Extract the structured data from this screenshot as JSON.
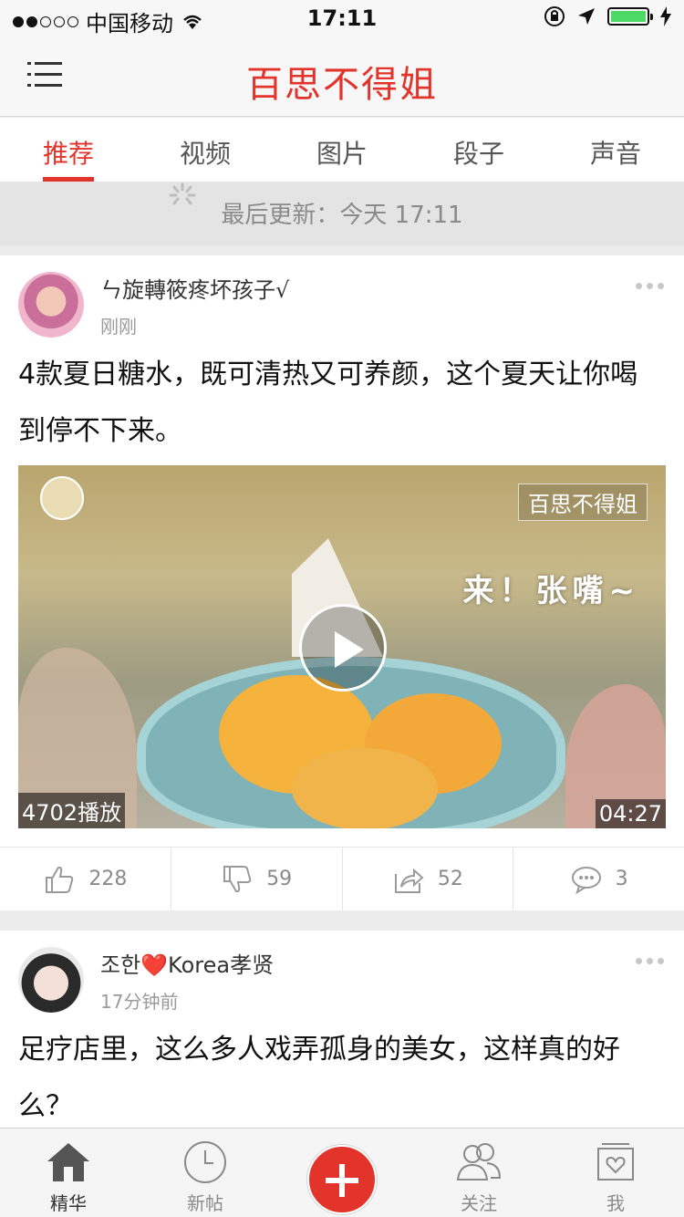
{
  "status_bar": {
    "carrier": "中国移动",
    "time": "17:11"
  },
  "nav": {
    "title": "百思不得姐"
  },
  "tabs": [
    {
      "label": "推荐",
      "active": true
    },
    {
      "label": "视频",
      "active": false
    },
    {
      "label": "图片",
      "active": false
    },
    {
      "label": "段子",
      "active": false
    },
    {
      "label": "声音",
      "active": false
    }
  ],
  "refresh": {
    "text": "最后更新：今天 17:11"
  },
  "posts": [
    {
      "username": "ㄣ旋轉筱疼坏孩子√",
      "time": "刚刚",
      "text": "4款夏日糖水，既可清热又可养颜，这个夏天让你喝到停不下来。",
      "video": {
        "watermark": "百思不得姐",
        "caption": "来！张嘴~",
        "plays": "4702播放",
        "duration": "04:27"
      },
      "actions": {
        "like": "228",
        "dislike": "59",
        "share": "52",
        "comment": "3"
      }
    },
    {
      "username": "조한❤️Korea孝贤",
      "time": "17分钟前",
      "text": "足疗店里，这么多人戏弄孤身的美女，这样真的好么？"
    }
  ],
  "tabbar": [
    {
      "label": "精华",
      "icon": "home-icon",
      "active": true
    },
    {
      "label": "新帖",
      "icon": "clock-icon",
      "active": false
    },
    {
      "label": "",
      "icon": "plus-icon",
      "active": false
    },
    {
      "label": "关注",
      "icon": "users-icon",
      "active": false
    },
    {
      "label": "我",
      "icon": "profile-icon",
      "active": false
    }
  ],
  "colors": {
    "accent": "#e3342b"
  }
}
